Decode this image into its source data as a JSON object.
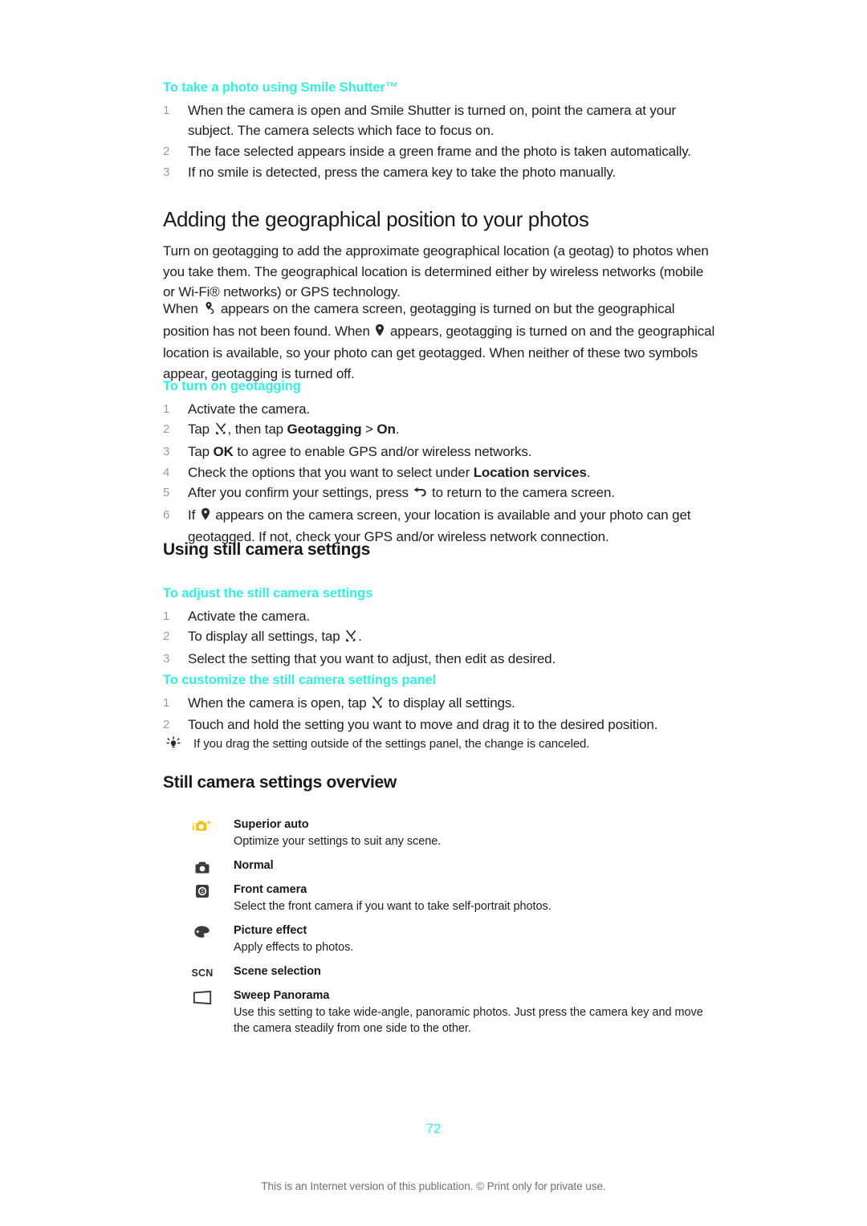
{
  "document": {
    "page_number": "72",
    "footer_note": "This is an Internet version of this publication. © Print only for private use.",
    "accent_color": "#34efe0",
    "icon_yellow": "#f5bf15"
  },
  "smile_shutter": {
    "heading": "To take a photo using Smile Shutter™",
    "steps": [
      "When the camera is open and Smile Shutter is turned on, point the camera at your subject. The camera selects which face to focus on.",
      "The face selected appears inside a green frame and the photo is taken automatically.",
      "If no smile is detected, press the camera key to take the photo manually."
    ]
  },
  "geotagging": {
    "heading": "Adding the geographical position to your photos",
    "paragraph_1": "Turn on geotagging to add the approximate geographical location (a geotag) to photos when you take them. The geographical location is determined either by wireless networks (mobile or Wi-Fi® networks) or GPS technology.",
    "paragraph_2": {
      "part_1": "When ",
      "icon_1": "gps-searching-icon",
      "part_2": " appears on the camera screen, geotagging is turned on but the geographical position has not been found. When ",
      "icon_2": "location-pin-icon",
      "part_3": " appears, geotagging is turned on and the geographical location is available, so your photo can get geotagged. When neither of these two symbols appear, geotagging is turned off."
    },
    "subheading": "To turn on geotagging",
    "steps": [
      {
        "parts": [
          {
            "t": "text",
            "v": "Activate the camera."
          }
        ]
      },
      {
        "parts": [
          {
            "t": "text",
            "v": "Tap "
          },
          {
            "t": "icon",
            "v": "settings-tools-icon"
          },
          {
            "t": "text",
            "v": ", then tap "
          },
          {
            "t": "bold",
            "v": "Geotagging"
          },
          {
            "t": "text",
            "v": " > "
          },
          {
            "t": "bold",
            "v": "On"
          },
          {
            "t": "text",
            "v": "."
          }
        ]
      },
      {
        "parts": [
          {
            "t": "text",
            "v": "Tap "
          },
          {
            "t": "bold",
            "v": "OK"
          },
          {
            "t": "text",
            "v": " to agree to enable GPS and/or wireless networks."
          }
        ]
      },
      {
        "parts": [
          {
            "t": "text",
            "v": "Check the options that you want to select under "
          },
          {
            "t": "bold",
            "v": "Location services"
          },
          {
            "t": "text",
            "v": "."
          }
        ]
      },
      {
        "parts": [
          {
            "t": "text",
            "v": "After you confirm your settings, press "
          },
          {
            "t": "icon",
            "v": "back-arrow-icon"
          },
          {
            "t": "text",
            "v": " to return to the camera screen."
          }
        ]
      },
      {
        "parts": [
          {
            "t": "text",
            "v": "If "
          },
          {
            "t": "icon",
            "v": "location-pin-icon"
          },
          {
            "t": "text",
            "v": " appears on the camera screen, your location is available and your photo can get geotagged. If not, check your GPS and/or wireless network connection."
          }
        ]
      }
    ]
  },
  "still_settings": {
    "heading": "Using still camera settings",
    "adjust": {
      "subheading": "To adjust the still camera settings",
      "steps": [
        {
          "parts": [
            {
              "t": "text",
              "v": "Activate the camera."
            }
          ]
        },
        {
          "parts": [
            {
              "t": "text",
              "v": "To display all settings, tap "
            },
            {
              "t": "icon",
              "v": "settings-tools-icon"
            },
            {
              "t": "text",
              "v": "."
            }
          ]
        },
        {
          "parts": [
            {
              "t": "text",
              "v": "Select the setting that you want to adjust, then edit as desired."
            }
          ]
        }
      ]
    },
    "customize": {
      "subheading": "To customize the still camera settings panel",
      "steps": [
        {
          "parts": [
            {
              "t": "text",
              "v": "When the camera is open, tap "
            },
            {
              "t": "icon",
              "v": "settings-tools-icon"
            },
            {
              "t": "text",
              "v": " to display all settings."
            }
          ]
        },
        {
          "parts": [
            {
              "t": "text",
              "v": "Touch and hold the setting you want to move and drag it to the desired position."
            }
          ]
        }
      ],
      "tip_icon": "lightbulb-tip-icon",
      "tip": "If you drag the setting outside of the settings panel, the change is canceled."
    }
  },
  "overview": {
    "heading": "Still camera settings overview",
    "items": [
      {
        "icon": "superior-auto-icon",
        "title": "Superior auto",
        "desc": "Optimize your settings to suit any scene."
      },
      {
        "icon": "normal-camera-icon",
        "title": "Normal",
        "desc": ""
      },
      {
        "icon": "front-camera-icon",
        "title": "Front camera",
        "desc": "Select the front camera if you want to take self-portrait photos."
      },
      {
        "icon": "picture-effect-palette-icon",
        "title": "Picture effect",
        "desc": "Apply effects to photos."
      },
      {
        "icon": "scene-selection-scn-icon",
        "title": "Scene selection",
        "desc": ""
      },
      {
        "icon": "sweep-panorama-icon",
        "title": "Sweep Panorama",
        "desc": "Use this setting to take wide-angle, panoramic photos. Just press the camera key and move the camera steadily from one side to the other."
      }
    ]
  }
}
